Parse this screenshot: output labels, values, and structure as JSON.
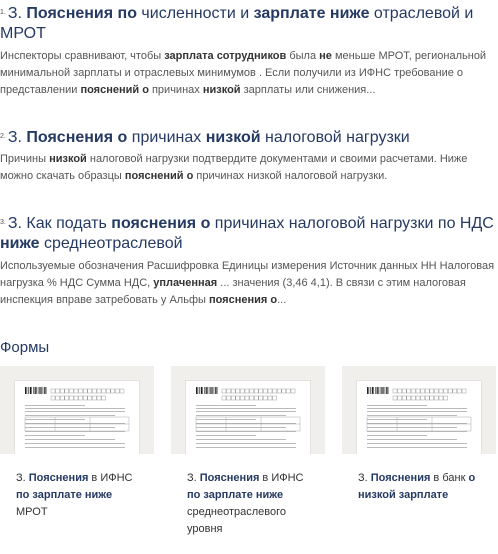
{
  "results": [
    {
      "number": "1.",
      "title_parts": [
        {
          "text": "З. ",
          "bold": false,
          "lead": true
        },
        {
          "text": "Пояснения по",
          "bold": true
        },
        {
          "text": " численности и ",
          "bold": false
        },
        {
          "text": "зарплате ниже",
          "bold": true
        },
        {
          "text": " отраслевой и МРОТ",
          "bold": false
        }
      ],
      "snippet_parts": [
        {
          "text": "Инспекторы сравнивают, чтобы ",
          "bold": false
        },
        {
          "text": "зарплата сотрудников",
          "bold": true
        },
        {
          "text": " была ",
          "bold": false
        },
        {
          "text": "не",
          "bold": true
        },
        {
          "text": " меньше МРОТ, региональной минимальной зарплаты и отраслевых минимумов . Если получили из ИФНС требование о представлении ",
          "bold": false
        },
        {
          "text": "пояснений о",
          "bold": true
        },
        {
          "text": " причинах ",
          "bold": false
        },
        {
          "text": "низкой",
          "bold": true
        },
        {
          "text": " зарплаты или снижения...",
          "bold": false
        }
      ]
    },
    {
      "number": "2.",
      "title_parts": [
        {
          "text": "З. ",
          "bold": false,
          "lead": true
        },
        {
          "text": "Пояснения о",
          "bold": true
        },
        {
          "text": " причинах ",
          "bold": false
        },
        {
          "text": "низкой",
          "bold": true
        },
        {
          "text": " налоговой нагрузки",
          "bold": false
        }
      ],
      "snippet_parts": [
        {
          "text": "Причины ",
          "bold": false
        },
        {
          "text": "низкой",
          "bold": true
        },
        {
          "text": " налоговой нагрузки подтвердите документами и своими расчетами. Ниже можно скачать образцы ",
          "bold": false
        },
        {
          "text": "пояснений о",
          "bold": true
        },
        {
          "text": " причинах низкой налоговой нагрузки.",
          "bold": false
        }
      ]
    },
    {
      "number": "3.",
      "title_parts": [
        {
          "text": "З. ",
          "bold": false,
          "lead": true
        },
        {
          "text": "Как подать ",
          "bold": false
        },
        {
          "text": "пояснения о",
          "bold": true
        },
        {
          "text": " причинах налоговой нагрузки по НДС ",
          "bold": false
        },
        {
          "text": "ниже",
          "bold": true
        },
        {
          "text": " среднеотраслевой",
          "bold": false
        }
      ],
      "snippet_parts": [
        {
          "text": "Используемые обозначения Расшифровка Единицы измерения Источник данных НН Налоговая нагрузка % НДС Сумма НДС, ",
          "bold": false
        },
        {
          "text": "уплаченная",
          "bold": true
        },
        {
          "text": " ... значения (3,46 4,1). В связи с этим налоговая инспекция вправе затребовать у Альфы ",
          "bold": false
        },
        {
          "text": "пояснения о",
          "bold": true
        },
        {
          "text": "...",
          "bold": false
        }
      ]
    }
  ],
  "forms": {
    "heading": "Формы",
    "cards": [
      {
        "label_parts": [
          {
            "text": "З. ",
            "bold": false
          },
          {
            "text": "Пояснения",
            "bold": true
          },
          {
            "text": " в ИФНС ",
            "bold": false
          },
          {
            "text": "по зарплате ниже",
            "bold": true
          },
          {
            "text": " МРОТ",
            "bold": false
          }
        ]
      },
      {
        "label_parts": [
          {
            "text": "З. ",
            "bold": false
          },
          {
            "text": "Пояснения",
            "bold": true
          },
          {
            "text": " в ИФНС ",
            "bold": false
          },
          {
            "text": "по зарплате ниже",
            "bold": true
          },
          {
            "text": " среднеотраслевого уровня",
            "bold": false
          }
        ]
      },
      {
        "label_parts": [
          {
            "text": "З. ",
            "bold": false
          },
          {
            "text": "Пояснения",
            "bold": true
          },
          {
            "text": " в банк ",
            "bold": false
          },
          {
            "text": "о низкой зарплате",
            "bold": true
          }
        ]
      }
    ]
  }
}
